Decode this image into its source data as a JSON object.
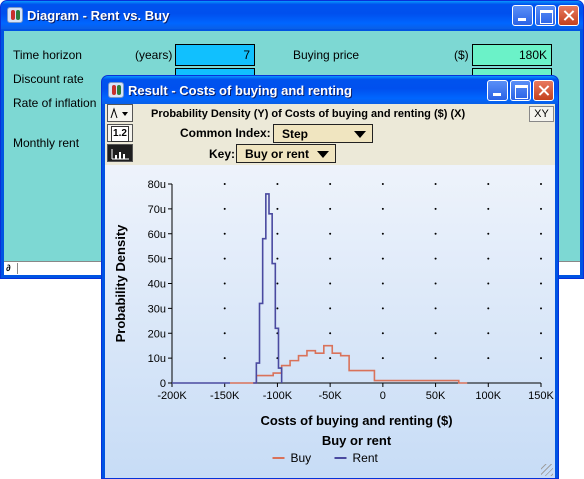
{
  "diagram_window": {
    "title": "Diagram - Rent vs. Buy",
    "fields": {
      "time_horizon": {
        "label": "Time horizon",
        "unit": "(years)",
        "value": "7"
      },
      "discount_rate": {
        "label": "Discount rate"
      },
      "rate_of_inflation": {
        "label": "Rate of inflation"
      },
      "monthly_rent": {
        "label": "Monthly rent"
      },
      "buying_price": {
        "label": "Buying price",
        "unit": "($)",
        "value": "180K"
      }
    },
    "status_symbol": "∂"
  },
  "result_window": {
    "title": "Result - Costs of buying and renting",
    "header_line": "Probability Density (Y) of Costs of buying and renting ($) (X)",
    "xy_button": "XY",
    "table_view_label": "1.2",
    "common_index": {
      "label": "Common Index:",
      "value": "Step"
    },
    "key": {
      "label": "Key:",
      "value": "Buy or rent"
    }
  },
  "colors": {
    "buy": "#d9725a",
    "rent": "#4a4aa0",
    "title_bar": "#0054e3",
    "diagram_bg": "#7dd8d3",
    "input_blue": "#11c0fe",
    "input_green": "#6bf2c8"
  },
  "chart_data": {
    "type": "line",
    "xlabel": "Costs of buying and renting ($)",
    "ylabel": "Probability Density",
    "xlim": [
      -200000,
      150000
    ],
    "ylim": [
      0,
      8e-05
    ],
    "x_ticks": [
      -200000,
      -150000,
      -100000,
      -50000,
      0,
      50000,
      100000,
      150000
    ],
    "x_tick_labels": [
      "-200K",
      "-150K",
      "-100K",
      "-50K",
      "0",
      "50K",
      "100K",
      "150K"
    ],
    "y_ticks": [
      0,
      1e-05,
      2e-05,
      3e-05,
      4e-05,
      5e-05,
      6e-05,
      7e-05,
      8e-05
    ],
    "y_tick_labels": [
      "0",
      "10u",
      "20u",
      "30u",
      "40u",
      "50u",
      "60u",
      "70u",
      "80u"
    ],
    "grid": "dots",
    "legend": {
      "title": "Buy or rent",
      "position": "bottom"
    },
    "series": [
      {
        "name": "Buy",
        "step": true,
        "x": [
          -145000,
          -120000,
          -112000,
          -104000,
          -96000,
          -88000,
          -80000,
          -72000,
          -64000,
          -56000,
          -48000,
          -40000,
          -32000,
          -8000,
          72000,
          80000
        ],
        "y": [
          0,
          3e-06,
          3e-06,
          4e-06,
          7e-06,
          9e-06,
          1.1e-05,
          1.3e-05,
          1.2e-05,
          1.5e-05,
          1.2e-05,
          1.1e-05,
          5e-06,
          1e-06,
          0,
          0
        ]
      },
      {
        "name": "Rent",
        "step": true,
        "x": [
          -123000,
          -120000,
          -117000,
          -114000,
          -111000,
          -108000,
          -105000,
          -102000,
          -99000,
          -96000
        ],
        "y": [
          0,
          8e-06,
          3.2e-05,
          5.8e-05,
          7.6e-05,
          6.8e-05,
          4.8e-05,
          2.2e-05,
          6e-06,
          0
        ]
      }
    ]
  }
}
